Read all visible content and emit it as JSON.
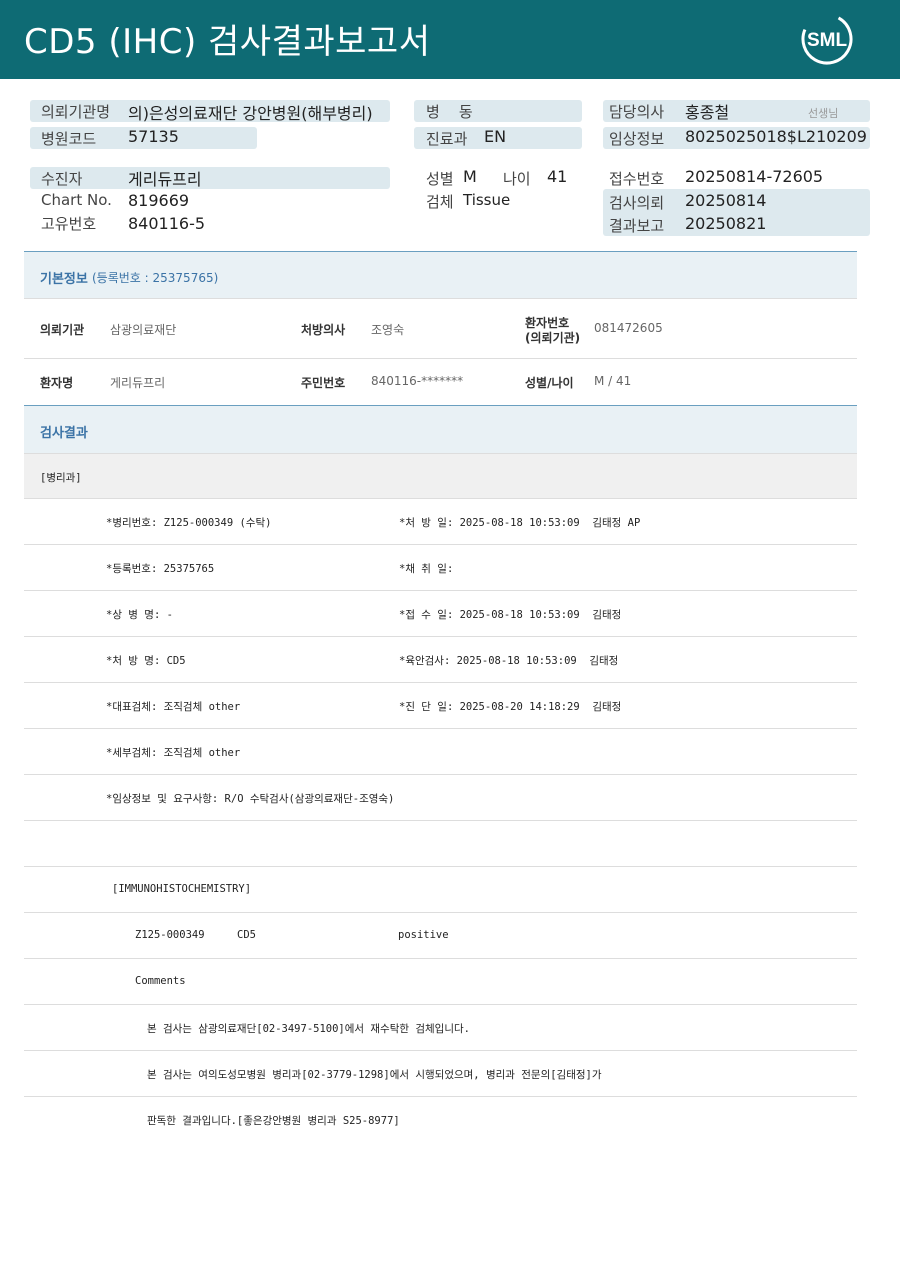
{
  "header": {
    "title": "CD5 (IHC) 검사결과보고서",
    "logo_text": "SML"
  },
  "top": {
    "referral_label": "의뢰기관명",
    "referral_value": "의)은성의료재단 강안병원(해부병리)",
    "hospcode_label": "병원코드",
    "hospcode_value": "57135",
    "ward_label": "병    동",
    "ward_value": "",
    "dept_label": "진료과",
    "dept_value": "EN",
    "doctor_label": "담당의사",
    "doctor_value": "홍종철",
    "doctor_suffix": "선생님",
    "clinical_label": "임상정보",
    "clinical_value": "8025025018$L210209",
    "patient_label": "수진자",
    "patient_value": "게리듀프리",
    "chart_label": "Chart No.",
    "chart_value": "819669",
    "uid_label": "고유번호",
    "uid_value": "840116-5",
    "sex_label": "성별",
    "sex_value": "M",
    "age_label": "나이",
    "age_value": "41",
    "specimen_label": "검체",
    "specimen_value": "Tissue",
    "receipt_label": "접수번호",
    "receipt_value": "20250814-72605",
    "request_label": "검사의뢰",
    "request_value": "20250814",
    "report_label": "결과보고",
    "report_value": "20250821"
  },
  "basic": {
    "title": "기본정보",
    "subtitle": "(등록번호 : 25375765)",
    "inst_label": "의뢰기관",
    "inst_value": "삼광의료재단",
    "rx_doc_label": "처방의사",
    "rx_doc_value": "조영숙",
    "pt_no_label_1": "환자번호",
    "pt_no_label_2": "(의뢰기관)",
    "pt_no_value": "081472605",
    "name_label": "환자명",
    "name_value": "게리듀프리",
    "rrn_label": "주민번호",
    "rrn_value": "840116-*******",
    "sexage_label": "성별/나이",
    "sexage_value": "M / 41"
  },
  "results": {
    "title": "검사결과",
    "dept_header": "[병리과]",
    "rows": [
      {
        "left": "*병리번호: Z125-000349 (수탁)",
        "right": "*처 방 일: 2025-08-18 10:53:09  김태정 AP"
      },
      {
        "left": "*등록번호: 25375765",
        "right": "*채 취 일:"
      },
      {
        "left": "*상 병 명: -",
        "right": "*접 수 일: 2025-08-18 10:53:09  김태정"
      },
      {
        "left": "*처 방 명: CD5",
        "right": "*육안검사: 2025-08-18 10:53:09  김태정"
      },
      {
        "left": "*대표검체: 조직검체 other",
        "right": "*진 단 일: 2025-08-20 14:18:29  김태정"
      },
      {
        "left": "*세부검체: 조직검체 other",
        "right": ""
      },
      {
        "left": "*임상정보 및 요구사항: R/O 수탁검사(삼광의료재단-조영숙)",
        "right": ""
      }
    ],
    "ihc_header": "[IMMUNOHISTOCHEMISTRY]",
    "ihc_id": "Z125-000349",
    "ihc_marker": "CD5",
    "ihc_result": "positive",
    "comments_label": "Comments",
    "comment_1": "본 검사는 삼광의료재단[02-3497-5100]에서 재수탁한 검체입니다.",
    "comment_2": "본 검사는 여의도성모병원 병리과[02-3779-1298]에서 시행되었으며, 병리과 전문의[김태정]가",
    "comment_3": "판독한 결과입니다.[좋은강안병원 병리과 S25-8977]"
  },
  "colors": {
    "header_bg": "#0e6b74",
    "pill_bg": "#dde9ee",
    "section_bg": "#e9f1f5",
    "accent_text": "#3b73a6"
  }
}
